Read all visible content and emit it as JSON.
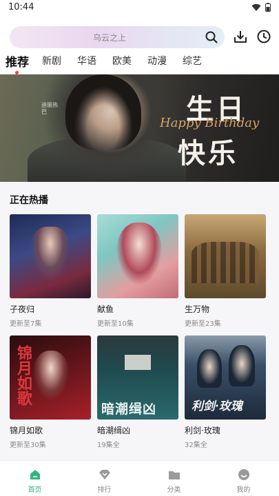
{
  "status_bar": {
    "time": "10:44"
  },
  "search": {
    "placeholder_text": "乌云之上"
  },
  "tabs": [
    {
      "label": "推荐",
      "active": true
    },
    {
      "label": "新剧"
    },
    {
      "label": "华语"
    },
    {
      "label": "欧美"
    },
    {
      "label": "动漫"
    },
    {
      "label": "综艺"
    }
  ],
  "banner": {
    "title_line1": "生日",
    "title_line2": "快乐",
    "script_text": "Happy Birthday",
    "caption": "迪丽热巴"
  },
  "section": {
    "title": "正在热播"
  },
  "cards": [
    {
      "title": "子夜归",
      "subtitle": "更新至7集",
      "colors": [
        "#2a3b6a",
        "#8a2a3a"
      ]
    },
    {
      "title": "献鱼",
      "subtitle": "更新至10集",
      "colors": [
        "#7fc6c2",
        "#d78a8e"
      ]
    },
    {
      "title": "生万物",
      "subtitle": "更新至23集",
      "colors": [
        "#8a6a3e",
        "#5e4a2c"
      ]
    },
    {
      "title": "锦月如歌",
      "subtitle": "更新至30集",
      "colors": [
        "#3a1416",
        "#a8202a"
      ]
    },
    {
      "title": "暗潮缉凶",
      "subtitle": "19集全",
      "colors": [
        "#1f4a4e",
        "#2a6a6e"
      ]
    },
    {
      "title": "利剑·玫瑰",
      "subtitle": "32集全",
      "colors": [
        "#1c2a3a",
        "#3a5068"
      ]
    }
  ],
  "poster_text": {
    "card4": "锦月如歌",
    "card5": "暗潮缉凶",
    "card6": "利剑·玫瑰"
  },
  "bottom_nav": [
    {
      "label": "首页",
      "icon": "home-icon",
      "active": true
    },
    {
      "label": "排行",
      "icon": "rank-icon"
    },
    {
      "label": "分类",
      "icon": "folder-icon"
    },
    {
      "label": "我的",
      "icon": "profile-icon"
    }
  ],
  "colors": {
    "accent": "#2fb87d",
    "tab_dot": "#ff3b3b"
  }
}
